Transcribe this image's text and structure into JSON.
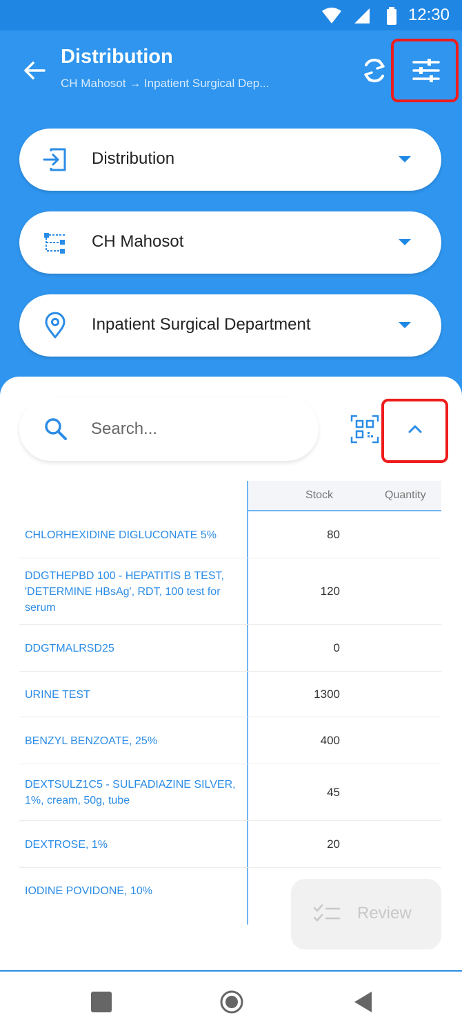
{
  "status_bar": {
    "time": "12:30"
  },
  "appbar": {
    "title": "Distribution",
    "subtitle": "CH Mahosot → Inpatient Surgical Dep..."
  },
  "selects": {
    "type": "Distribution",
    "facility": "CH Mahosot",
    "department": "Inpatient Surgical Department"
  },
  "search": {
    "placeholder": "Search..."
  },
  "table": {
    "headers": {
      "stock": "Stock",
      "quantity": "Quantity"
    },
    "rows": [
      {
        "name": "CHLORHEXIDINE DIGLUCONATE 5%",
        "stock": "80"
      },
      {
        "name": "DDGTHEPBD 100 - HEPATITIS B TEST, 'DETERMINE HBsAg', RDT, 100 test for serum",
        "stock": "120"
      },
      {
        "name": "DDGTMALRSD25",
        "stock": "0"
      },
      {
        "name": "URINE TEST",
        "stock": "1300"
      },
      {
        "name": "BENZYL BENZOATE, 25%",
        "stock": "400"
      },
      {
        "name": "DEXTSULZ1C5 - SULFADIAZINE SILVER, 1%, cream, 50g, tube",
        "stock": "45"
      },
      {
        "name": "DEXTROSE, 1%",
        "stock": "20"
      },
      {
        "name": "IODINE POVIDONE, 10%",
        "stock": ""
      }
    ]
  },
  "review_button": {
    "label": "Review"
  },
  "colors": {
    "primary": "#2f95ee",
    "status_bar": "#1f86e3",
    "link_text": "#2b8ce6",
    "highlight": "#ee1c1c"
  }
}
